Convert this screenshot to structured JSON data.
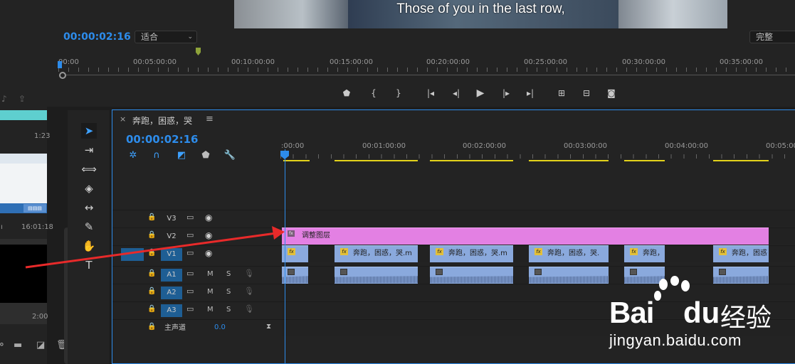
{
  "program_monitor": {
    "subtitle": "Those of you in the last row,",
    "timecode": "00:00:02:16",
    "zoom_value": "适合",
    "quality_value": "完整",
    "ruler_labels": [
      "00:00",
      "00:05:00:00",
      "00:10:00:00",
      "00:15:00:00",
      "00:20:00:00",
      "00:25:00:00",
      "00:30:00:00",
      "00:35:00:00"
    ],
    "transport_icons": [
      "add-marker-icon",
      "mark-in-icon",
      "mark-out-icon",
      "go-to-in-icon",
      "step-back-icon",
      "play-icon",
      "step-forward-icon",
      "go-to-out-icon",
      "lift-icon",
      "extract-icon",
      "export-frame-icon"
    ]
  },
  "project_panel": {
    "duration_1": "1:23",
    "time_1": "16:01:18",
    "duration_2": "2:00"
  },
  "tools": [
    "selection-tool",
    "track-select-tool",
    "ripple-edit-tool",
    "razor-tool",
    "slip-tool",
    "pen-tool",
    "hand-tool",
    "type-tool"
  ],
  "timeline": {
    "sequence_name": "奔跑，困惑，哭",
    "close_symbol": "×",
    "menu_symbol": "≡",
    "timecode": "00:00:02:16",
    "ruler_labels": [
      ":00:00",
      "00:01:00:00",
      "00:02:00:00",
      "00:03:00:00",
      "00:04:00:00",
      "00:05:00"
    ],
    "tracks": {
      "v3": "V3",
      "v2": "V2",
      "v1": "V1",
      "a1": "A1",
      "a2": "A2",
      "a3": "A3",
      "m": "M",
      "s": "S",
      "master": "主声道",
      "master_volume": "0.0"
    },
    "adjustment_clip": "调整图层",
    "video_clips": [
      "奔跑，困惑，哭.m",
      "奔跑，困惑，哭.m",
      "奔跑，困惑，哭.",
      "奔跑，",
      "奔跑，困惑"
    ],
    "fx_label": "fx"
  },
  "watermark": {
    "bai": "Bai",
    "du": "du",
    "jingyan": "经验",
    "url": "jingyan.baidu.com"
  },
  "colors": {
    "accent": "#2d8ceb",
    "adjustment_layer": "#e380e3",
    "clip": "#8aa9dd",
    "annotation_arrow": "#e82a2a"
  }
}
